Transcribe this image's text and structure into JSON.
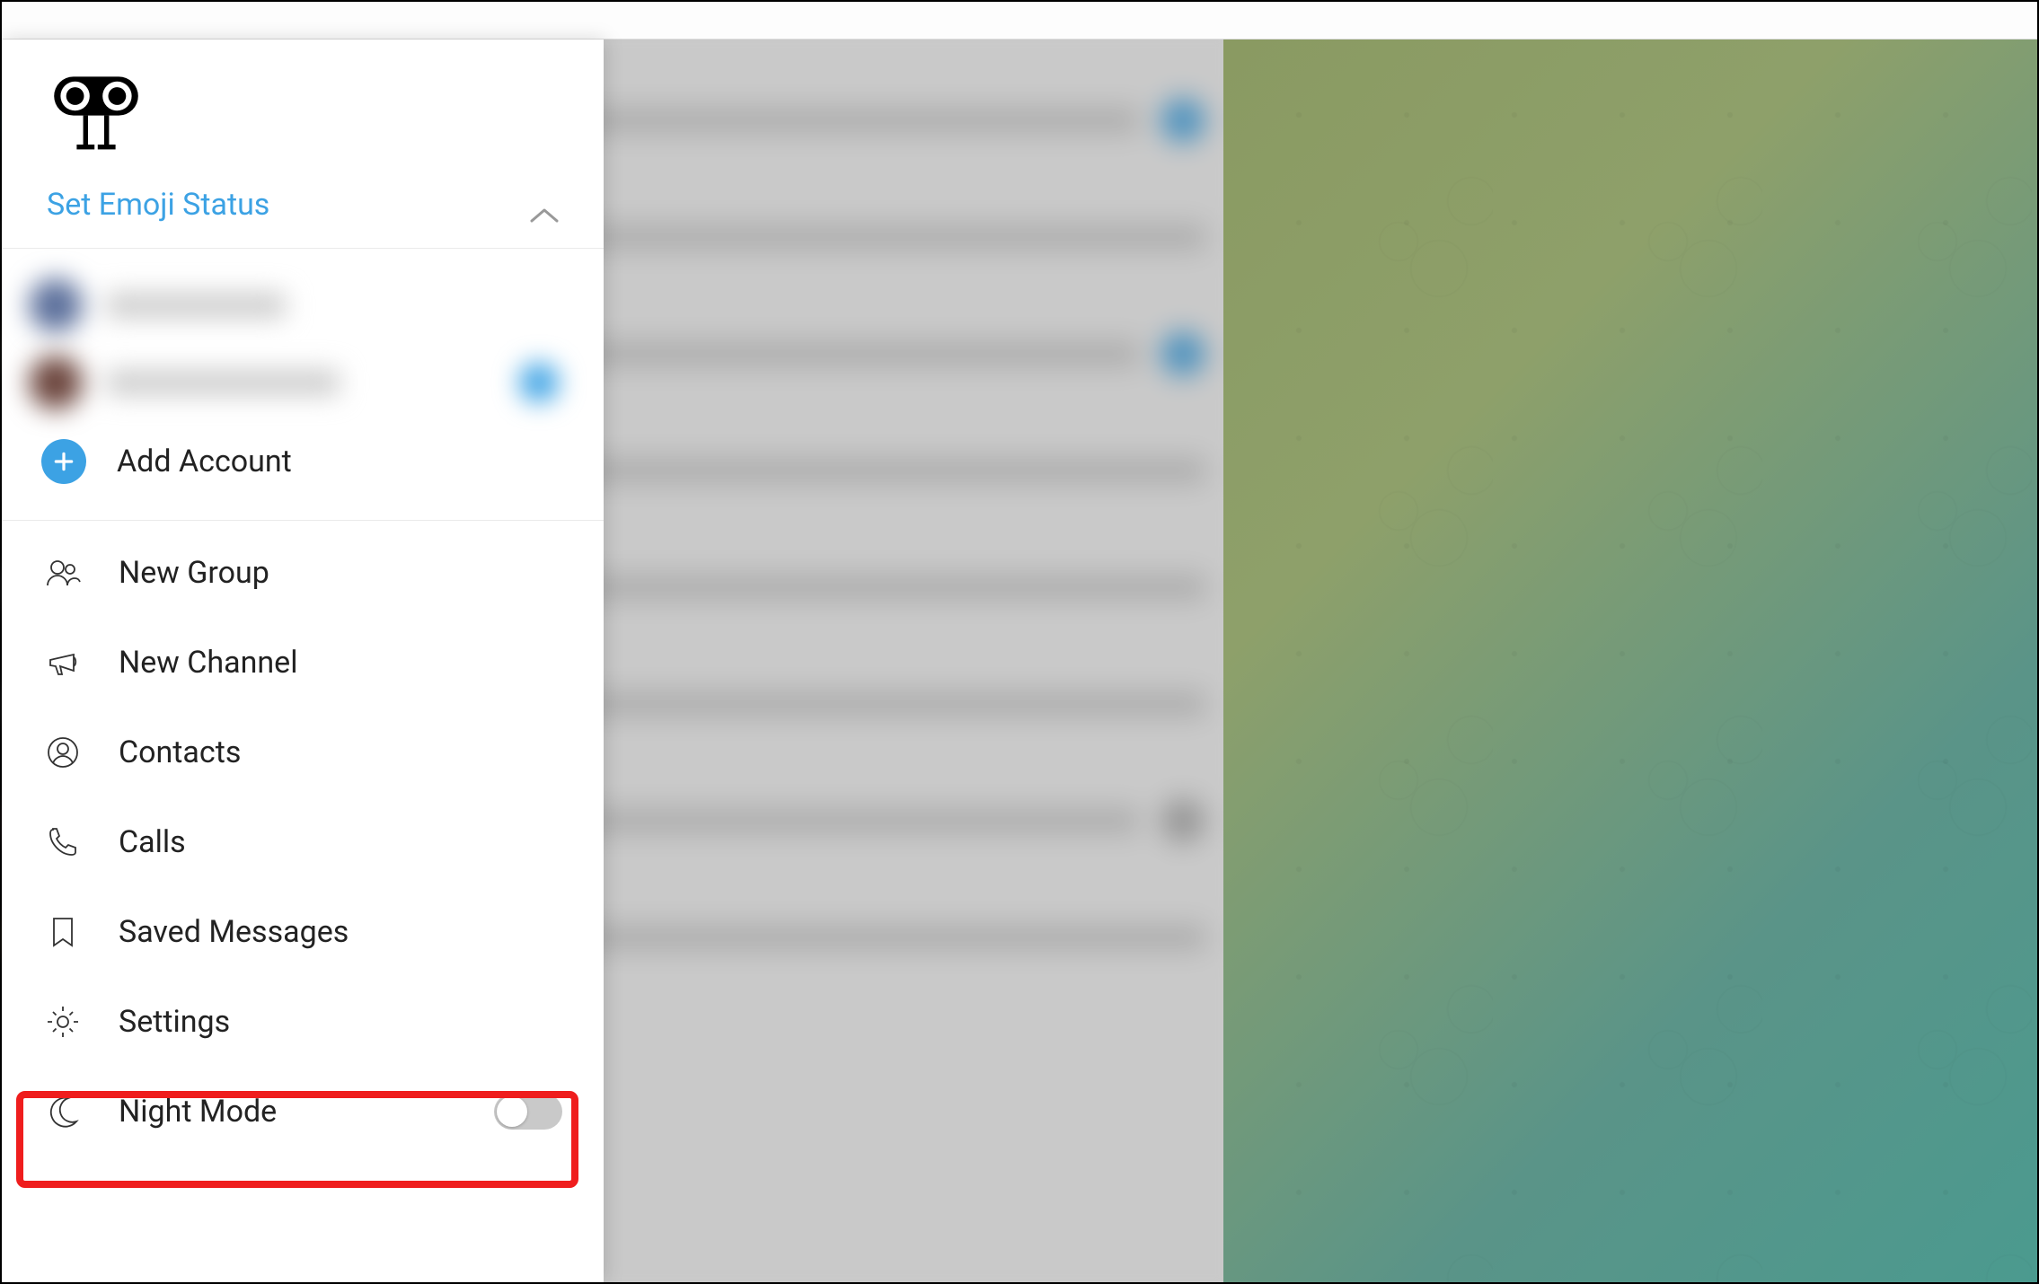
{
  "drawer": {
    "emoji_status_label": "Set Emoji Status",
    "add_account_label": "Add Account",
    "menu": {
      "new_group": "New Group",
      "new_channel": "New Channel",
      "contacts": "Contacts",
      "calls": "Calls",
      "saved_messages": "Saved Messages",
      "settings": "Settings",
      "night_mode": "Night Mode"
    },
    "night_mode_on": false
  },
  "highlight_target": "settings",
  "colors": {
    "accent": "#3ca2e4",
    "highlight_border": "#ef1d1d"
  }
}
